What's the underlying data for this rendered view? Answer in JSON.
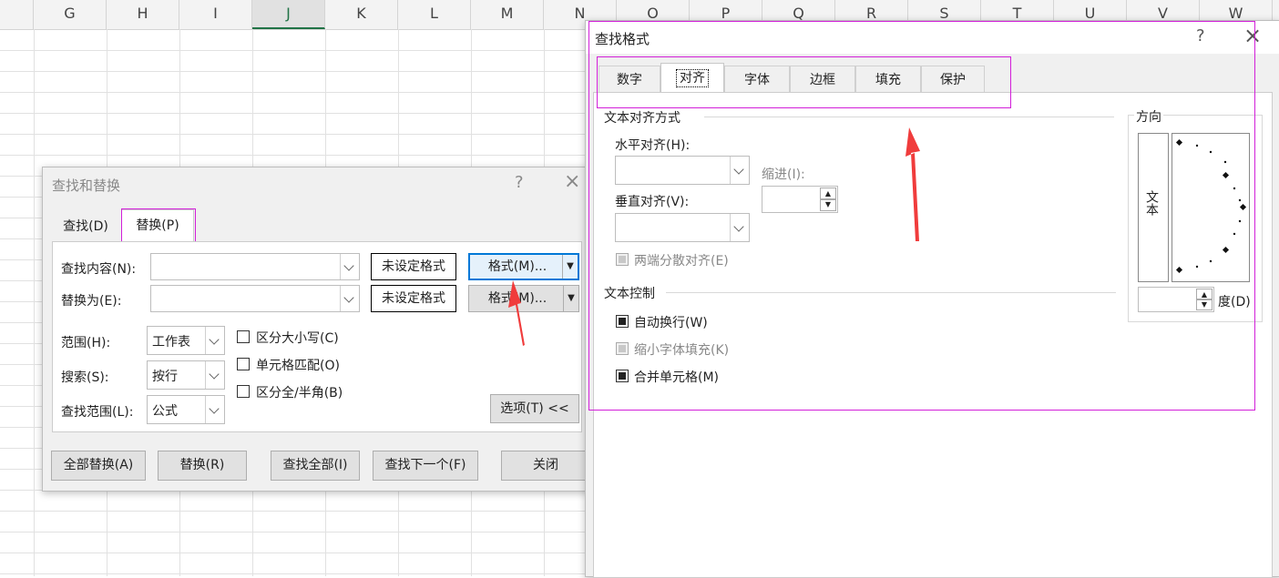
{
  "spreadsheet": {
    "columns": [
      "G",
      "H",
      "I",
      "J",
      "K",
      "L",
      "M",
      "N",
      "O",
      "P",
      "Q",
      "R",
      "S",
      "T",
      "U",
      "V",
      "W"
    ],
    "selected_column": "J"
  },
  "find_replace": {
    "title": "查找和替换",
    "help": "?",
    "close": "×",
    "tabs": [
      {
        "label": "查找(D)",
        "active": false
      },
      {
        "label": "替换(P)",
        "active": true
      }
    ],
    "find_label": "查找内容(N):",
    "find_value": "",
    "replace_label": "替换为(E):",
    "replace_value": "",
    "format_preview_1": "未设定格式",
    "format_preview_2": "未设定格式",
    "format_button": "格式(M)...",
    "within_label": "范围(H):",
    "within_value": "工作表",
    "search_label": "搜索(S):",
    "search_value": "按行",
    "lookin_label": "查找范围(L):",
    "lookin_value": "公式",
    "match_case": "区分大小写(C)",
    "match_cell": "单元格匹配(O)",
    "match_width": "区分全/半角(B)",
    "options_button": "选项(T) <<",
    "buttons": {
      "replace_all": "全部替换(A)",
      "replace": "替换(R)",
      "find_all": "查找全部(I)",
      "find_next": "查找下一个(F)",
      "close": "关闭"
    }
  },
  "find_format": {
    "title": "查找格式",
    "help": "?",
    "close": "×",
    "tabs": [
      "数字",
      "对齐",
      "字体",
      "边框",
      "填充",
      "保护"
    ],
    "active_tab": "对齐",
    "text_alignment": {
      "group": "文本对齐方式",
      "horizontal_label": "水平对齐(H):",
      "horizontal_value": "",
      "vertical_label": "垂直对齐(V):",
      "vertical_value": "",
      "indent_label": "缩进(I):",
      "indent_value": "",
      "justify_distributed": "两端分散对齐(E)"
    },
    "text_control": {
      "group": "文本控制",
      "wrap_text": "自动换行(W)",
      "shrink_to_fit": "缩小字体填充(K)",
      "merge_cells": "合并单元格(M)",
      "wrap_checked": true,
      "merge_checked": true
    },
    "orientation": {
      "group": "方向",
      "vertical_text": "文本",
      "degrees_value": "",
      "degrees_label": "度(D)"
    }
  },
  "annotation_color": "#d21fd9",
  "arrow_color": "#f03c3c"
}
